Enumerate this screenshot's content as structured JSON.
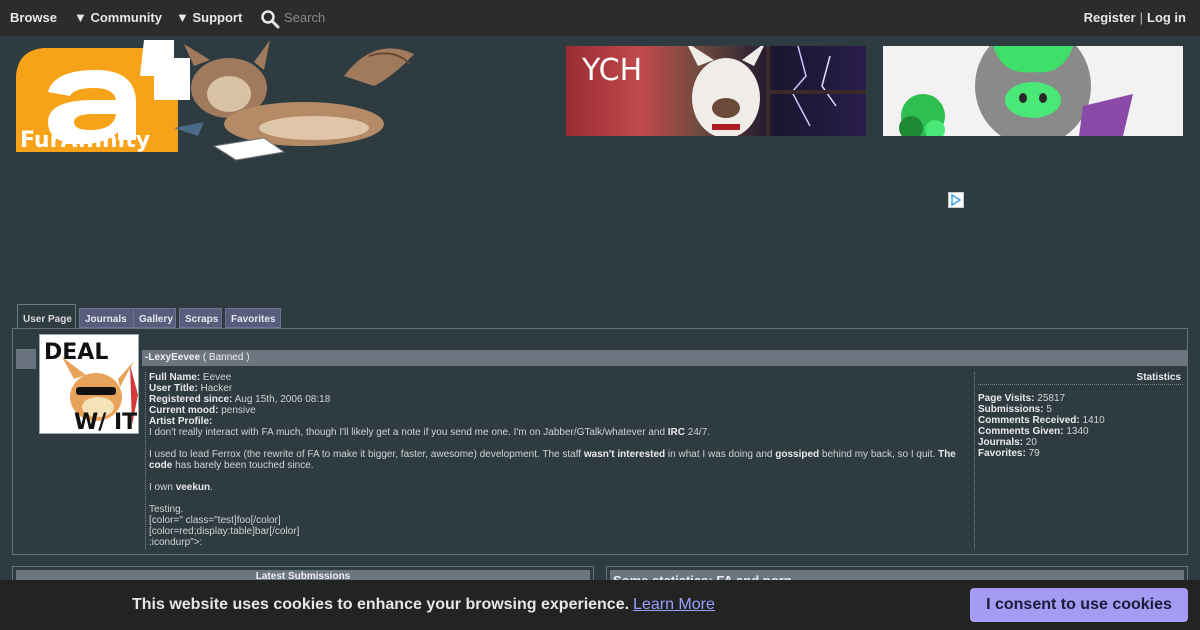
{
  "nav": {
    "browse": "Browse",
    "community": "▼ Community",
    "support": "▼ Support",
    "search_placeholder": "Search",
    "register": "Register",
    "separator": "|",
    "login": "Log in"
  },
  "banner": {
    "logo_text": "FurAffinity",
    "ad1_text": "YCH"
  },
  "tabs": [
    "User Page",
    "Journals",
    "Gallery",
    "Scraps",
    "Favorites"
  ],
  "profile": {
    "username": "-LexyEevee",
    "status": "( Banned )",
    "avatar_text_top": "DEAL",
    "avatar_text_bottom": "W/ IT",
    "fields": {
      "full_name_label": "Full Name:",
      "full_name": "Eevee",
      "user_title_label": "User Title:",
      "user_title": "Hacker",
      "registered_label": "Registered since:",
      "registered": "Aug 15th, 2006 08:18",
      "mood_label": "Current mood:",
      "mood": "pensive",
      "artist_profile_label": "Artist Profile:"
    },
    "bio": {
      "p1_a": "I don't really interact with FA much, though I'll likely get a note if you send me one. I'm on Jabber/GTalk/whatever and ",
      "p1_b": "IRC",
      "p1_c": " 24/7.",
      "p2_a": "I used to lead Ferrox (the rewrite of FA to make it bigger, faster, awesome) development. The staff ",
      "p2_b": "wasn't interested",
      "p2_c": " in what I was doing and ",
      "p2_d": "gossiped",
      "p2_e": " behind my back, so I quit. ",
      "p2_f": "The code",
      "p2_g": " has barely been touched since.",
      "p3_a": "I own ",
      "p3_b": "veekun",
      "p3_c": ".",
      "p4": "Testing.",
      "p5": "[color=\" class=\"test]foo[/color]",
      "p6": "[color=red;display:table]bar[/color]",
      "p7": ":icondurp\">:"
    }
  },
  "statistics": {
    "title": "Statistics",
    "page_visits_label": "Page Visits:",
    "page_visits": "25817",
    "submissions_label": "Submissions:",
    "submissions": "5",
    "comments_received_label": "Comments Received:",
    "comments_received": "1410",
    "comments_given_label": "Comments Given:",
    "comments_given": "1340",
    "journals_label": "Journals:",
    "journals": "20",
    "favorites_label": "Favorites:",
    "favorites": "79"
  },
  "lower": {
    "latest_title": "Latest Submissions",
    "journal_title": "Some statistics: FA and porn"
  },
  "cookie": {
    "message": "This website uses cookies to enhance your browsing experience.",
    "learn_more": "Learn More",
    "consent": "I consent to use cookies"
  }
}
